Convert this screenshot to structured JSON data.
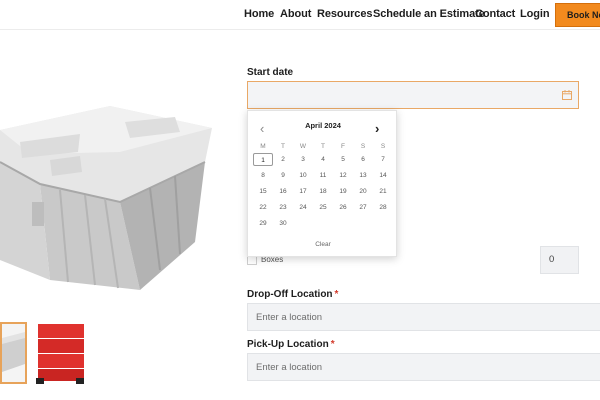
{
  "nav": {
    "items": [
      "Home",
      "About",
      "Resources",
      "Schedule an Estimate",
      "Contact",
      "Login"
    ],
    "book_button": "Book Now"
  },
  "form": {
    "start_date_label": "Start date",
    "dropoff_label": "Drop-Off Location",
    "dropoff_placeholder": "Enter a location",
    "pickup_label": "Pick-Up Location",
    "pickup_placeholder": "Enter a location",
    "required_marker": "*",
    "boxes_label": "Boxes",
    "quantity_value": "0"
  },
  "calendar": {
    "month_title": "April 2024",
    "weekdays": [
      "M",
      "T",
      "W",
      "T",
      "F",
      "S",
      "S"
    ],
    "days": [
      "1",
      "2",
      "3",
      "4",
      "5",
      "6",
      "7",
      "8",
      "9",
      "10",
      "11",
      "12",
      "13",
      "14",
      "15",
      "16",
      "17",
      "18",
      "19",
      "20",
      "21",
      "22",
      "23",
      "24",
      "25",
      "26",
      "27",
      "28",
      "29",
      "30"
    ],
    "today": "1",
    "clear_label": "Clear",
    "prev_icon": "chevron-left-icon",
    "next_icon": "chevron-right-icon"
  },
  "colors": {
    "accent": "#f28a1e",
    "input_focus_border": "#e9a866",
    "required": "#d23a2b",
    "thumb_red": "#e0322e"
  }
}
